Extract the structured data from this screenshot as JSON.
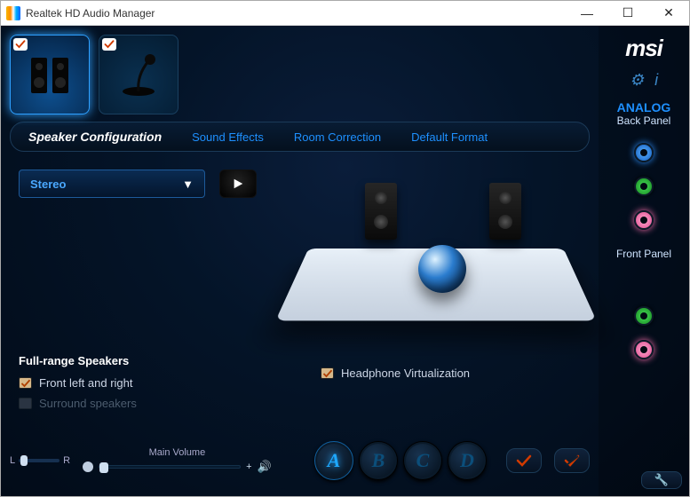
{
  "window": {
    "title": "Realtek HD Audio Manager"
  },
  "brand": "msi",
  "devices": {
    "speakers": {
      "selected": true,
      "checked": true
    },
    "microphone": {
      "selected": false,
      "checked": true
    }
  },
  "tabs": [
    {
      "id": "speaker-config",
      "label": "Speaker Configuration",
      "active": true
    },
    {
      "id": "sound-effects",
      "label": "Sound Effects",
      "active": false
    },
    {
      "id": "room-correction",
      "label": "Room Correction",
      "active": false
    },
    {
      "id": "default-format",
      "label": "Default Format",
      "active": false
    }
  ],
  "config": {
    "mode_selected": "Stereo",
    "full_range_title": "Full-range Speakers",
    "front_lr": {
      "label": "Front left and right",
      "checked": true,
      "enabled": true
    },
    "surround": {
      "label": "Surround speakers",
      "checked": false,
      "enabled": false
    },
    "hp_virt": {
      "label": "Headphone Virtualization",
      "checked": true
    }
  },
  "volume": {
    "balance_left_label": "L",
    "balance_right_label": "R",
    "main_label": "Main Volume",
    "level_percent": 0,
    "balance_percent": 5
  },
  "presets": [
    {
      "letter": "A",
      "active": true
    },
    {
      "letter": "B",
      "active": false
    },
    {
      "letter": "C",
      "active": false
    },
    {
      "letter": "D",
      "active": false
    }
  ],
  "sidebar": {
    "analog_label": "ANALOG",
    "back_panel_label": "Back Panel",
    "front_panel_label": "Front Panel",
    "back_jacks": [
      "blue",
      "green",
      "pink"
    ],
    "front_jacks": [
      "green",
      "pink"
    ]
  },
  "colors": {
    "accent": "#1e90ff",
    "jack_blue": "#2b90ff",
    "jack_green": "#1aa030",
    "jack_pink": "#ff70b0"
  }
}
